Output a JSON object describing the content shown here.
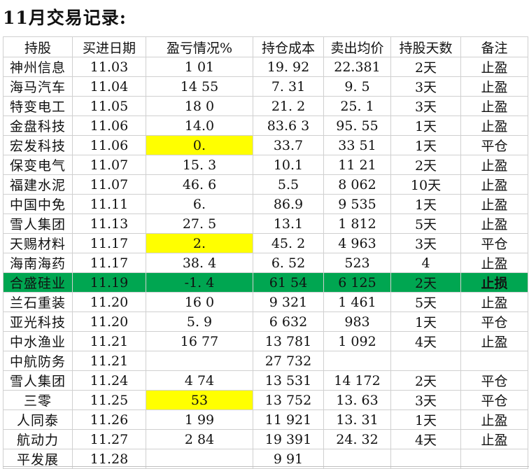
{
  "title": "11月交易记录:",
  "headers": [
    "持股",
    "买进日期",
    "盈亏情况%",
    "持仓成本",
    "卖出均价",
    "持股天数",
    "备注"
  ],
  "rows": [
    {
      "name": "神州信息",
      "date": "11.03",
      "pnl": "1 01",
      "cost": "19. 92",
      "sell": "22.381",
      "days": "2天",
      "note": "止盈",
      "hl": false,
      "loss": false
    },
    {
      "name": "海马汽车",
      "date": "11.04",
      "pnl": "14 55",
      "cost": "7. 31",
      "sell": "9. 5",
      "days": "3天",
      "note": "止盈",
      "hl": false,
      "loss": false
    },
    {
      "name": "特变电工",
      "date": "11.05",
      "pnl": "18 0",
      "cost": "21. 2",
      "sell": "25. 1",
      "days": "3天",
      "note": "止盈",
      "hl": false,
      "loss": false
    },
    {
      "name": "金盘科技",
      "date": "11.06",
      "pnl": "14.0",
      "cost": "83.6 3",
      "sell": "95. 55",
      "days": "1天",
      "note": "止盈",
      "hl": false,
      "loss": false
    },
    {
      "name": "宏发科技",
      "date": "11.06",
      "pnl": "0.",
      "cost": "33.7",
      "sell": "33 51",
      "days": "1天",
      "note": "平仓",
      "hl": true,
      "loss": false
    },
    {
      "name": "保变电气",
      "date": "11.07",
      "pnl": "15. 3",
      "cost": "10.1",
      "sell": "11 21",
      "days": "2天",
      "note": "止盈",
      "hl": false,
      "loss": false
    },
    {
      "name": "福建水泥",
      "date": "11.07",
      "pnl": "46. 6",
      "cost": "5.5",
      "sell": "8 062",
      "days": "10天",
      "note": "止盈",
      "hl": false,
      "loss": false
    },
    {
      "name": "中国中免",
      "date": "11.11",
      "pnl": "6.",
      "cost": "86.9",
      "sell": "9 535",
      "days": "1天",
      "note": "止盈",
      "hl": false,
      "loss": false
    },
    {
      "name": "雪人集团",
      "date": "11.13",
      "pnl": "27. 5",
      "cost": "13.1",
      "sell": "1 812",
      "days": "5天",
      "note": "止盈",
      "hl": false,
      "loss": false
    },
    {
      "name": "天赐材料",
      "date": "11.17",
      "pnl": "2.",
      "cost": "45. 2",
      "sell": "4 963",
      "days": "3天",
      "note": "平仓",
      "hl": true,
      "loss": false
    },
    {
      "name": "海南海药",
      "date": "11.17",
      "pnl": "38. 4",
      "cost": "6. 52",
      "sell": "523",
      "days": "4",
      "note": "止盈",
      "hl": false,
      "loss": false
    },
    {
      "name": "合盛硅业",
      "date": "11.19",
      "pnl": "-1. 4",
      "cost": "61 54",
      "sell": "6 125",
      "days": "2天",
      "note": "止损",
      "hl": false,
      "loss": true
    },
    {
      "name": "兰石重装",
      "date": "11.20",
      "pnl": "16 0",
      "cost": "9 321",
      "sell": "1 461",
      "days": "5天",
      "note": "止盈",
      "hl": false,
      "loss": false
    },
    {
      "name": "亚光科技",
      "date": "11.20",
      "pnl": "5. 9",
      "cost": "6 632",
      "sell": "983",
      "days": "1天",
      "note": "平仓",
      "hl": false,
      "loss": false
    },
    {
      "name": "中水渔业",
      "date": "11.21",
      "pnl": "16 77",
      "cost": "13 781",
      "sell": "1 092",
      "days": "4天",
      "note": "止盈",
      "hl": false,
      "loss": false
    },
    {
      "name": "中航防务",
      "date": "11.21",
      "pnl": "",
      "cost": "27 732",
      "sell": "",
      "days": "",
      "note": "",
      "hl": false,
      "loss": false
    },
    {
      "name": "雪人集团",
      "date": "11.24",
      "pnl": "4 74",
      "cost": "13 531",
      "sell": "14 172",
      "days": "2天",
      "note": "平仓",
      "hl": false,
      "loss": false
    },
    {
      "name": "三零",
      "date": "11.25",
      "pnl": "53",
      "cost": "13 752",
      "sell": "13. 63",
      "days": "3天",
      "note": "平仓",
      "hl": true,
      "loss": false
    },
    {
      "name": "人同泰",
      "date": "11.26",
      "pnl": "1 99",
      "cost": "11 921",
      "sell": "13. 31",
      "days": "1天",
      "note": "止盈",
      "hl": false,
      "loss": false
    },
    {
      "name": "航动力",
      "date": "11.27",
      "pnl": "2 84",
      "cost": "19 391",
      "sell": "24. 32",
      "days": "4天",
      "note": "止盈",
      "hl": false,
      "loss": false
    },
    {
      "name": "平发展",
      "date": "11.28",
      "pnl": "",
      "cost": "9 91",
      "sell": "",
      "days": "",
      "note": "",
      "hl": false,
      "loss": false
    }
  ],
  "colors": {
    "highlight": "#ffff00",
    "loss_row": "#00a651",
    "grid": "#d0d0d0"
  }
}
